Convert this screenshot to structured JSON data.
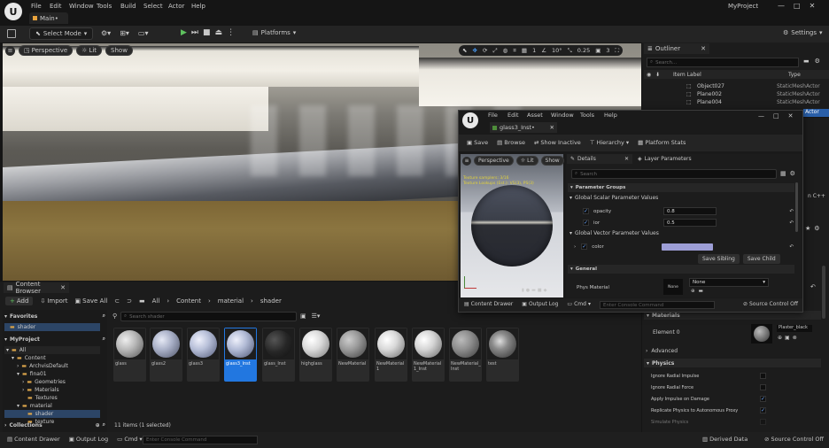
{
  "menubar": {
    "items": [
      "File",
      "Edit",
      "Window",
      "Tools",
      "Build",
      "Select",
      "Actor",
      "Help"
    ],
    "project": "MyProject"
  },
  "level_tab": "Main•",
  "toolbar": {
    "select_mode": "Select Mode",
    "platforms": "Platforms",
    "settings": "Settings"
  },
  "viewport": {
    "perspective": "Perspective",
    "lit": "Lit",
    "show": "Show",
    "fov": "10°",
    "snap": "0.25",
    "speed": "3"
  },
  "outliner": {
    "title": "Outliner",
    "search_placeholder": "Search...",
    "col_label": "Item Label",
    "col_type": "Type",
    "rows": [
      {
        "label": "Object027",
        "type": "StaticMeshActor"
      },
      {
        "label": "Plane002",
        "type": "StaticMeshActor"
      },
      {
        "label": "Plane004",
        "type": "StaticMeshActor"
      }
    ],
    "partial_type_1": "Actor",
    "partial_type_2": "n C++"
  },
  "details": {
    "materials_header": "Materials",
    "element0": "Element 0",
    "element0_value": "Plaster_black",
    "advanced": "Advanced",
    "physics_header": "Physics",
    "physics_rows": [
      {
        "label": "Ignore Radial Impulse",
        "checked": false
      },
      {
        "label": "Ignore Radial Force",
        "checked": false
      },
      {
        "label": "Apply Impulse on Damage",
        "checked": true
      },
      {
        "label": "Replicate Physics to Autonomous Proxy",
        "checked": true
      },
      {
        "label": "Simulate Physics",
        "checked": false
      }
    ]
  },
  "content_browser": {
    "tab": "Content Browser",
    "add": "Add",
    "import": "Import",
    "save_all": "Save All",
    "breadcrumb": [
      "All",
      "Content",
      "material",
      "shader"
    ],
    "search_placeholder": "Search shader",
    "favorites": "Favorites",
    "favorite_items": [
      "shader"
    ],
    "myproject": "MyProject",
    "tree": [
      {
        "label": "All",
        "depth": 0
      },
      {
        "label": "Content",
        "depth": 1
      },
      {
        "label": "ArchvisDefault",
        "depth": 2
      },
      {
        "label": "fina01",
        "depth": 2
      },
      {
        "label": "Geometries",
        "depth": 3
      },
      {
        "label": "Materials",
        "depth": 3
      },
      {
        "label": "Textures",
        "depth": 3
      },
      {
        "label": "material",
        "depth": 2
      },
      {
        "label": "shader",
        "depth": 3
      },
      {
        "label": "texture",
        "depth": 3
      }
    ],
    "collections": "Collections",
    "status": "11 items (1 selected)",
    "assets": [
      {
        "label": "glass",
        "color": "#b9b9b9"
      },
      {
        "label": "glass2",
        "color": "#aab1c8"
      },
      {
        "label": "glass3",
        "color": "#b7bfd8"
      },
      {
        "label": "glass3_Inst",
        "color": "#b2bbd6"
      },
      {
        "label": "glass_Inst",
        "color": "#262626"
      },
      {
        "label": "highglass",
        "color": "#dadada"
      },
      {
        "label": "NewMaterial",
        "color": "#9a9a9a"
      },
      {
        "label": "NewMaterial1",
        "color": "#d8d8d8"
      },
      {
        "label": "NewMaterial1_Inst",
        "color": "#d4d4d4"
      },
      {
        "label": "NewMaterial_Inst",
        "color": "#8e8e8e"
      },
      {
        "label": "test",
        "color": "#8a8a8a"
      }
    ]
  },
  "statusbar": {
    "content_drawer": "Content Drawer",
    "output_log": "Output Log",
    "cmd": "Cmd",
    "console_placeholder": "Enter Console Command",
    "derived_data": "Derived Data",
    "source_control": "Source Control Off"
  },
  "mi_editor": {
    "menu": [
      "File",
      "Edit",
      "Asset",
      "Window",
      "Tools",
      "Help"
    ],
    "tab": "glass3_Inst•",
    "toolbar": [
      "Save",
      "Browse",
      "Show Inactive",
      "Hierarchy",
      "Platform Stats"
    ],
    "viewport": {
      "perspective": "Perspective",
      "lit": "Lit",
      "show": "Show",
      "stat1": "Texture samplers: 3/16",
      "stat2": "Texture Lookups (Est.): VS(3), PS(3)"
    },
    "details_tab": "Details",
    "layer_tab": "Layer Parameters",
    "search_placeholder": "Search",
    "param_groups": "Parameter Groups",
    "scalar_group": "Global Scalar Parameter Values",
    "scalar_params": [
      {
        "name": "opacity",
        "value": "0.8"
      },
      {
        "name": "ior",
        "value": "0.5"
      }
    ],
    "vector_group": "Global Vector Parameter Values",
    "vector_param": {
      "name": "color",
      "swatch": "#9d9ed6"
    },
    "save_sibling": "Save Sibling",
    "save_child": "Save Child",
    "general": "General",
    "phys_material": "Phys Material",
    "none_thumb": "None",
    "phys_value": "None",
    "bottom": {
      "content_drawer": "Content Drawer",
      "output_log": "Output Log",
      "cmd": "Cmd",
      "console_placeholder": "Enter Console Command",
      "source_control": "Source Control Off"
    }
  }
}
